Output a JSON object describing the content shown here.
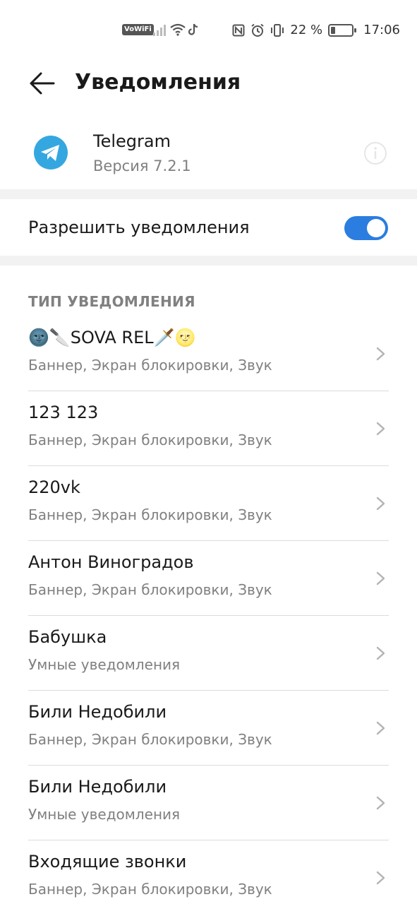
{
  "status_bar": {
    "vowifi": "VoWiFi",
    "battery_percent": "22 %",
    "battery_level": 0.22,
    "time": "17:06",
    "icons": [
      "signal-icon",
      "wifi-icon",
      "tiktok-icon",
      "nfc-icon",
      "alarm-icon",
      "vibrate-icon",
      "battery-icon"
    ]
  },
  "header": {
    "title": "Уведомления",
    "back_icon": "arrow-left-icon"
  },
  "app": {
    "name": "Telegram",
    "version": "Версия 7.2.1",
    "icon": "telegram-icon",
    "info_icon": "info-icon"
  },
  "allow": {
    "label": "Разрешить уведомления",
    "enabled": true
  },
  "section": {
    "title": "ТИП УВЕДОМЛЕНИЯ"
  },
  "items": [
    {
      "name": "🌚🔪SOVA REL🗡️🌝",
      "sub": "Баннер, Экран блокировки, Звук"
    },
    {
      "name": "123 123",
      "sub": "Баннер, Экран блокировки, Звук"
    },
    {
      "name": "220vk",
      "sub": "Баннер, Экран блокировки, Звук"
    },
    {
      "name": "Антон Виноградов",
      "sub": "Баннер, Экран блокировки, Звук"
    },
    {
      "name": "Бабушка",
      "sub": "Умные уведомления"
    },
    {
      "name": "Били Недобили",
      "sub": "Баннер, Экран блокировки, Звук"
    },
    {
      "name": "Били Недобили",
      "sub": "Умные уведомления"
    },
    {
      "name": "Входящие звонки",
      "sub": "Баннер, Экран блокировки, Звук"
    }
  ],
  "colors": {
    "accent": "#2b7de0",
    "telegram": "#35a7e0",
    "secondary_text": "#808080",
    "band": "#f2f2f2"
  }
}
